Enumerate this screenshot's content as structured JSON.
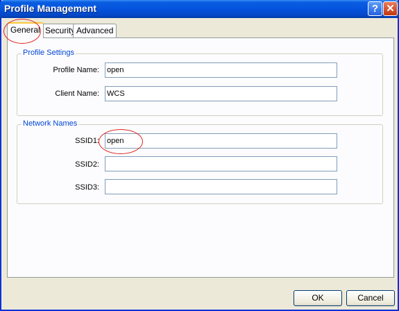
{
  "window": {
    "title": "Profile Management",
    "help_label": "?",
    "close_label": "✕"
  },
  "tabs": [
    {
      "label": "General",
      "active": true
    },
    {
      "label": "Security",
      "active": false
    },
    {
      "label": "Advanced",
      "active": false
    }
  ],
  "profile_settings": {
    "legend": "Profile Settings",
    "profile_name_label": "Profile Name:",
    "profile_name_value": "open",
    "client_name_label": "Client Name:",
    "client_name_value": "WCS"
  },
  "network_names": {
    "legend": "Network Names",
    "ssid1_label": "SSID1:",
    "ssid1_value": "open",
    "ssid2_label": "SSID2:",
    "ssid2_value": "",
    "ssid3_label": "SSID3:",
    "ssid3_value": ""
  },
  "buttons": {
    "ok": "OK",
    "cancel": "Cancel"
  },
  "colors": {
    "titlebar": "#0553de",
    "highlight": "#e0231b",
    "legend": "#0046d5",
    "dialog_bg": "#ece9d8"
  },
  "icons": [
    "help-icon",
    "close-icon"
  ]
}
